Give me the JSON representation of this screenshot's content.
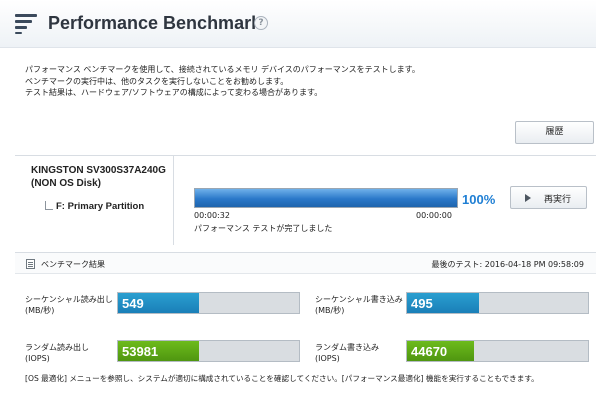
{
  "header": {
    "title": "Performance Benchmark",
    "help_label": "?"
  },
  "description": [
    "パフォーマンス ベンチマークを使用して、接続されているメモリ デバイスのパフォーマンスをテストします。",
    "ベンチマークの実行中は、他のタスクを実行しないことをお勧めします。",
    "テスト結果は、ハードウェア/ソフトウェアの構成によって変わる場合があります。"
  ],
  "history_button": "履歴",
  "device": {
    "name": "KINGSTON SV300S37A240G (NON OS Disk)",
    "partition": "F: Primary Partition"
  },
  "progress": {
    "percent_label": "100%",
    "percent_value": 100,
    "elapsed": "00:00:32",
    "remaining": "00:00:00",
    "status": "パフォーマンス テストが完了しました"
  },
  "rerun_button": "再実行",
  "results": {
    "title": "ベンチマーク結果",
    "last_test": "最後のテスト: 2016-04-18 PM 09:58:09",
    "metrics": [
      {
        "label1": "シーケンシャル読み出し",
        "label2": "(MB/秒)",
        "value": "549",
        "fill": 0.45,
        "color": "#1a8fc4"
      },
      {
        "label1": "シーケンシャル書き込み",
        "label2": "(MB/秒)",
        "value": "495",
        "fill": 0.4,
        "color": "#1a8fc4"
      },
      {
        "label1": "ランダム読み出し",
        "label2": "(IOPS)",
        "value": "53981",
        "fill": 0.45,
        "color": "#5fa816"
      },
      {
        "label1": "ランダム書き込み",
        "label2": "(IOPS)",
        "value": "44670",
        "fill": 0.37,
        "color": "#5fa816"
      }
    ]
  },
  "footnote": "[OS 最適化] メニューを参照し、システムが適切に構成されていることを確認してください。[パフォーマンス最適化] 機能を実行することもできます。"
}
